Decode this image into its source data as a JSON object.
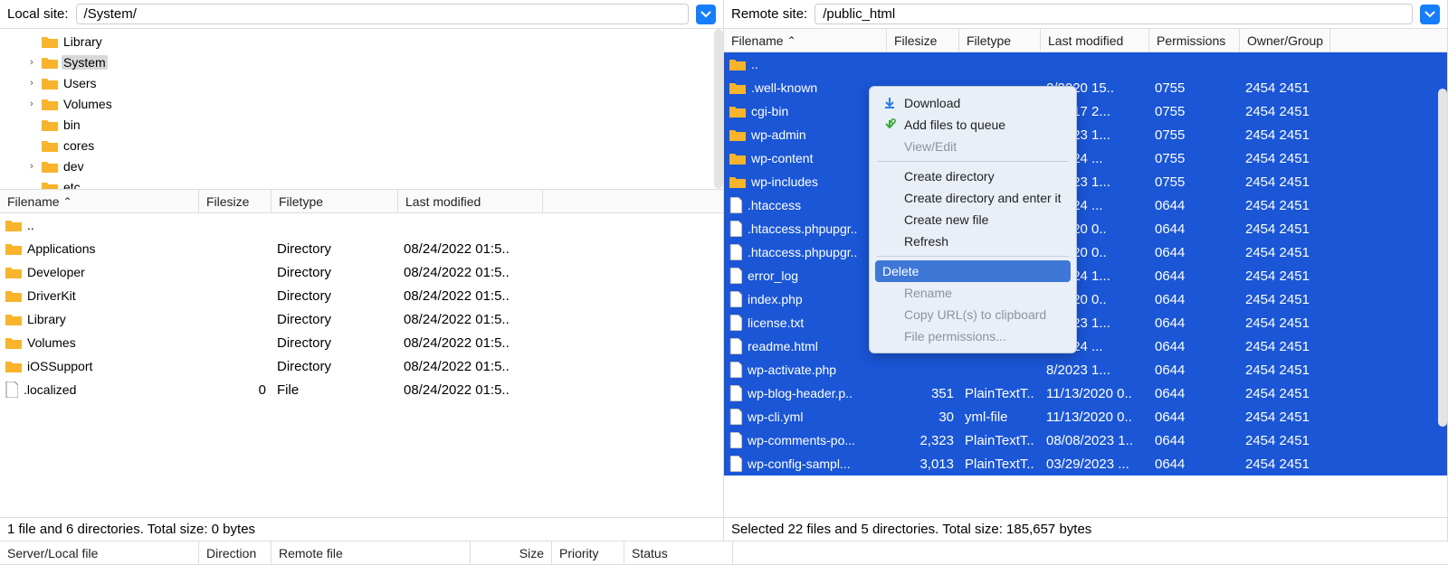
{
  "local": {
    "label": "Local site:",
    "path": "/System/",
    "tree": [
      {
        "indent": 1,
        "expander": "",
        "name": "Library",
        "selected": false
      },
      {
        "indent": 1,
        "expander": "›",
        "name": "System",
        "selected": true
      },
      {
        "indent": 1,
        "expander": "›",
        "name": "Users",
        "selected": false
      },
      {
        "indent": 1,
        "expander": "›",
        "name": "Volumes",
        "selected": false
      },
      {
        "indent": 1,
        "expander": "",
        "name": "bin",
        "selected": false
      },
      {
        "indent": 1,
        "expander": "",
        "name": "cores",
        "selected": false
      },
      {
        "indent": 1,
        "expander": "›",
        "name": "dev",
        "selected": false
      },
      {
        "indent": 1,
        "expander": "",
        "name": "etc",
        "selected": false
      }
    ],
    "headers": {
      "name": "Filename",
      "size": "Filesize",
      "type": "Filetype",
      "mod": "Last modified"
    },
    "files": [
      {
        "icon": "folder",
        "name": "..",
        "size": "",
        "type": "",
        "mod": ""
      },
      {
        "icon": "folder",
        "name": "Applications",
        "size": "",
        "type": "Directory",
        "mod": "08/24/2022 01:5.."
      },
      {
        "icon": "folder",
        "name": "Developer",
        "size": "",
        "type": "Directory",
        "mod": "08/24/2022 01:5.."
      },
      {
        "icon": "folder",
        "name": "DriverKit",
        "size": "",
        "type": "Directory",
        "mod": "08/24/2022 01:5.."
      },
      {
        "icon": "folder",
        "name": "Library",
        "size": "",
        "type": "Directory",
        "mod": "08/24/2022 01:5.."
      },
      {
        "icon": "folder",
        "name": "Volumes",
        "size": "",
        "type": "Directory",
        "mod": "08/24/2022 01:5.."
      },
      {
        "icon": "folder",
        "name": "iOSSupport",
        "size": "",
        "type": "Directory",
        "mod": "08/24/2022 01:5.."
      },
      {
        "icon": "file",
        "name": ".localized",
        "size": "0",
        "type": "File",
        "mod": "08/24/2022 01:5.."
      }
    ],
    "status": "1 file and 6 directories. Total size: 0 bytes"
  },
  "remote": {
    "label": "Remote site:",
    "path": "/public_html",
    "headers": {
      "name": "Filename",
      "size": "Filesize",
      "type": "Filetype",
      "mod": "Last modified",
      "perm": "Permissions",
      "own": "Owner/Group"
    },
    "files": [
      {
        "icon": "folder",
        "name": "..",
        "size": "",
        "type": "",
        "mod": "",
        "perm": "",
        "own": ""
      },
      {
        "icon": "folder",
        "name": ".well-known",
        "size": "",
        "type": "",
        "mod": "2/2020 15..",
        "perm": "0755",
        "own": "2454 2451"
      },
      {
        "icon": "folder",
        "name": "cgi-bin",
        "size": "",
        "type": "",
        "mod": "2/2017 2...",
        "perm": "0755",
        "own": "2454 2451"
      },
      {
        "icon": "folder",
        "name": "wp-admin",
        "size": "",
        "type": "",
        "mod": "8/2023 1...",
        "perm": "0755",
        "own": "2454 2451"
      },
      {
        "icon": "folder",
        "name": "wp-content",
        "size": "",
        "type": "",
        "mod": "8/2024 ...",
        "perm": "0755",
        "own": "2454 2451"
      },
      {
        "icon": "folder",
        "name": "wp-includes",
        "size": "",
        "type": "",
        "mod": "7/2023 1...",
        "perm": "0755",
        "own": "2454 2451"
      },
      {
        "icon": "file",
        "name": ".htaccess",
        "size": "",
        "type": "",
        "mod": "8/2024 ...",
        "perm": "0644",
        "own": "2454 2451"
      },
      {
        "icon": "file",
        "name": ".htaccess.phpupgr..",
        "size": "",
        "type": "",
        "mod": "7/2020 0..",
        "perm": "0644",
        "own": "2454 2451"
      },
      {
        "icon": "file",
        "name": ".htaccess.phpupgr..",
        "size": "",
        "type": "",
        "mod": "7/2020 0..",
        "perm": "0644",
        "own": "2454 2451"
      },
      {
        "icon": "file",
        "name": "error_log",
        "size": "",
        "type": "",
        "mod": "7/2024 1...",
        "perm": "0644",
        "own": "2454 2451"
      },
      {
        "icon": "file",
        "name": "index.php",
        "size": "",
        "type": "",
        "mod": "3/2020 0..",
        "perm": "0644",
        "own": "2454 2451"
      },
      {
        "icon": "file",
        "name": "license.txt",
        "size": "",
        "type": "",
        "mod": "7/2023 1...",
        "perm": "0644",
        "own": "2454 2451"
      },
      {
        "icon": "file",
        "name": "readme.html",
        "size": "",
        "type": "",
        "mod": "0/2024 ...",
        "perm": "0644",
        "own": "2454 2451"
      },
      {
        "icon": "file",
        "name": "wp-activate.php",
        "size": "",
        "type": "",
        "mod": "8/2023 1...",
        "perm": "0644",
        "own": "2454 2451"
      },
      {
        "icon": "file",
        "name": "wp-blog-header.p..",
        "size": "351",
        "type": "PlainTextT..",
        "mod": "11/13/2020 0..",
        "perm": "0644",
        "own": "2454 2451"
      },
      {
        "icon": "file",
        "name": "wp-cli.yml",
        "size": "30",
        "type": "yml-file",
        "mod": "11/13/2020 0..",
        "perm": "0644",
        "own": "2454 2451"
      },
      {
        "icon": "file",
        "name": "wp-comments-po...",
        "size": "2,323",
        "type": "PlainTextT..",
        "mod": "08/08/2023 1..",
        "perm": "0644",
        "own": "2454 2451"
      },
      {
        "icon": "file",
        "name": "wp-config-sampl...",
        "size": "3,013",
        "type": "PlainTextT..",
        "mod": "03/29/2023 ...",
        "perm": "0644",
        "own": "2454 2451"
      }
    ],
    "status": "Selected 22 files and 5 directories. Total size: 185,657 bytes"
  },
  "context_menu": {
    "download": "Download",
    "add_queue": "Add files to queue",
    "view_edit": "View/Edit",
    "create_dir": "Create directory",
    "create_dir_enter": "Create directory and enter it",
    "create_file": "Create new file",
    "refresh": "Refresh",
    "delete": "Delete",
    "rename": "Rename",
    "copy_url": "Copy URL(s) to clipboard",
    "file_perm": "File permissions..."
  },
  "queue_headers": {
    "server": "Server/Local file",
    "direction": "Direction",
    "remote": "Remote file",
    "size": "Size",
    "priority": "Priority",
    "status": "Status"
  }
}
